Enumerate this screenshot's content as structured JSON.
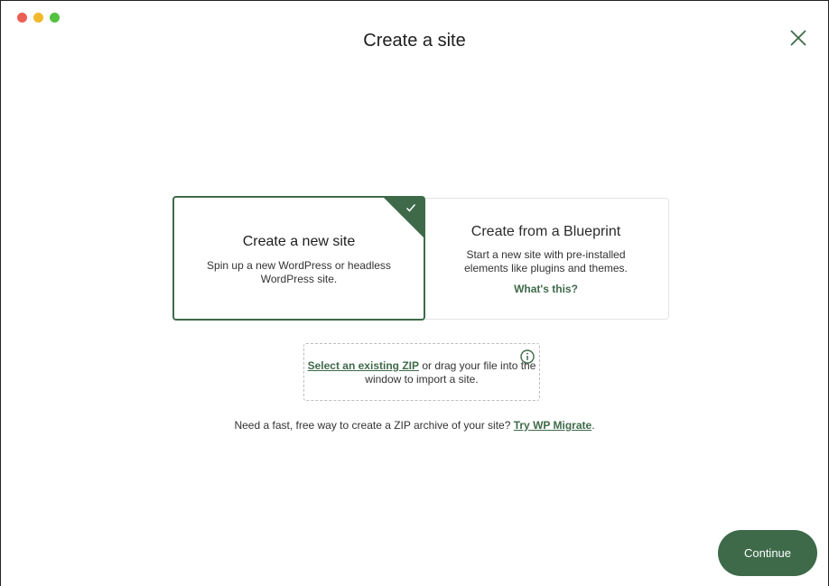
{
  "window": {
    "title": "Create a site"
  },
  "colors": {
    "accent": "#3e6a4a",
    "border_light": "#e4e4e4",
    "dashed_border": "#bdbdbd"
  },
  "options": [
    {
      "title": "Create a new site",
      "description": "Spin up a new WordPress or headless WordPress site.",
      "selected": true
    },
    {
      "title": "Create from a Blueprint",
      "description": "Start a new site with pre-installed elements like plugins and themes.",
      "link": "What's this?",
      "selected": false
    }
  ],
  "dropzone": {
    "link": "Select an existing ZIP",
    "text": " or drag your file into the window to import a site.",
    "icon": "info-icon"
  },
  "migrate": {
    "text": "Need a fast, free way to create a ZIP archive of your site? ",
    "link": "Try WP Migrate",
    "suffix": "."
  },
  "actions": {
    "continue_label": "Continue"
  }
}
